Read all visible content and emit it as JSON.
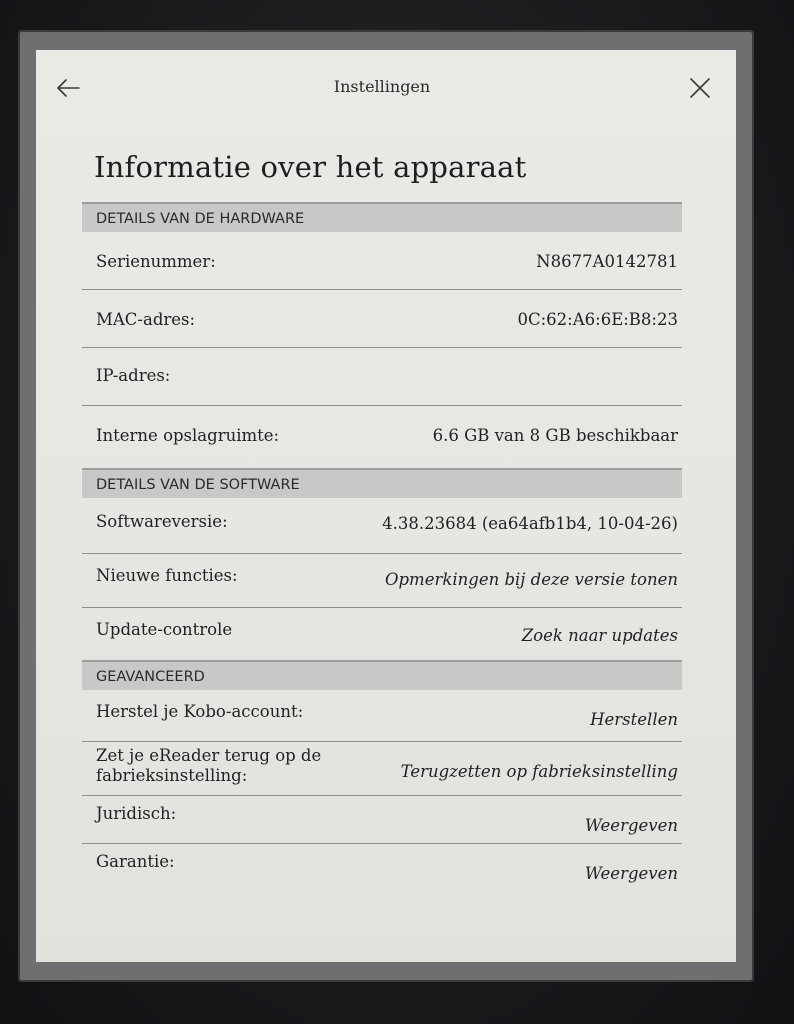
{
  "header": {
    "title": "Instellingen",
    "back_icon": "arrow-left-icon",
    "close_icon": "close-icon"
  },
  "page_title": "Informatie over het apparaat",
  "sections": {
    "hardware": {
      "title": "DETAILS VAN DE HARDWARE",
      "rows": [
        {
          "label": "Serienummer:",
          "value": "N8677A0142781"
        },
        {
          "label": "MAC-adres:",
          "value": "0C:62:A6:6E:B8:23"
        },
        {
          "label": "IP-adres:",
          "value": ""
        },
        {
          "label": "Interne opslagruimte:",
          "value": "6.6 GB van 8 GB beschikbaar"
        }
      ]
    },
    "software": {
      "title": "DETAILS VAN DE SOFTWARE",
      "rows": [
        {
          "label": "Softwareversie:",
          "value": "4.38.23684 (ea64afb1b4, 10-04-26)"
        },
        {
          "label": "Nieuwe functies:",
          "value": "Opmerkingen bij deze versie tonen"
        },
        {
          "label": "Update-controle",
          "value": "Zoek naar updates"
        }
      ]
    },
    "advanced": {
      "title": "GEAVANCEERD",
      "rows": [
        {
          "label": "Herstel je Kobo-account:",
          "value": "Herstellen"
        },
        {
          "label": "Zet je eReader terug op de fabrieksinstelling:",
          "value": "Terugzetten op fabrieksinstelling"
        },
        {
          "label": "Juridisch:",
          "value": "Weergeven"
        },
        {
          "label": "Garantie:",
          "value": "Weergeven"
        }
      ]
    }
  },
  "colors": {
    "screen_bg": "#e6e7e3",
    "section_header_bg": "#c8c9c6",
    "divider": "#8e8f8c",
    "text": "#222222"
  }
}
